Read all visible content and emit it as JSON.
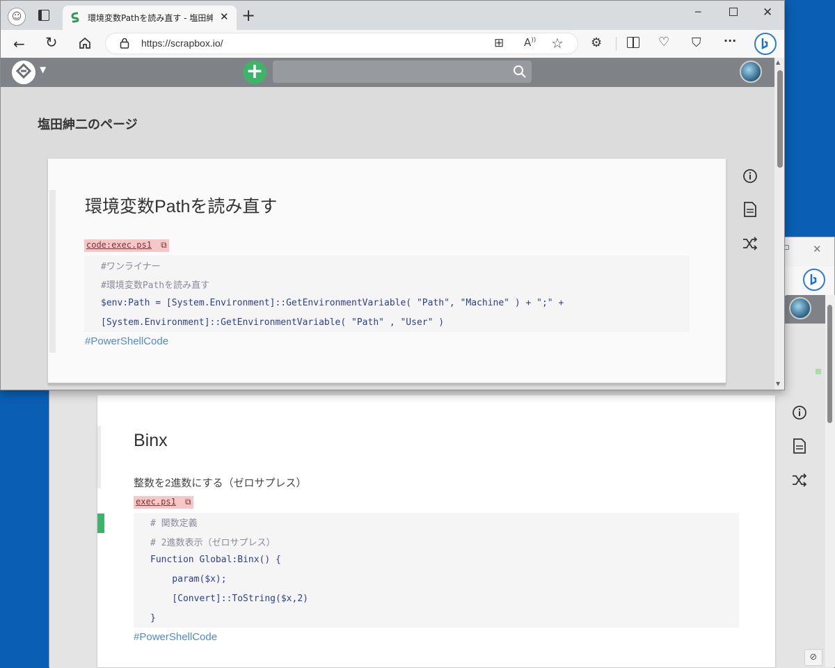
{
  "browser": {
    "tab_title": "環境変数Pathを読み直す - 塩田紳",
    "url": "https://scrapbox.io/",
    "new_tab": "+",
    "minimize": "─",
    "maximize": "☐",
    "close": "✕",
    "more": "···"
  },
  "scrapbox": {
    "project_title": "塩田紳二のページ",
    "search_placeholder": ""
  },
  "page1": {
    "title": "環境変数Pathを読み直す",
    "code_label": "code:exec.ps1",
    "code_lines": [
      "#ワンライナー",
      "#環境変数Pathを読み直す",
      "$env:Path = [System.Environment]::GetEnvironmentVariable( \"Path\", \"Machine\" ) + \";\" +",
      "[System.Environment]::GetEnvironmentVariable( \"Path\" , \"User\" )"
    ],
    "hashtag": "#PowerShellCode"
  },
  "page2": {
    "title": "Binx",
    "description": "整数を2進数にする（ゼロサプレス）",
    "code_label": "exec.ps1",
    "code_lines": [
      "# 関数定義",
      "# 2進数表示（ゼロサプレス）",
      "Function Global:Binx() {",
      "    param($x);",
      "    [Convert]::ToString($x,2)",
      "}"
    ],
    "hashtag": "#PowerShellCode"
  },
  "colors": {
    "accent_green": "#3fb36a",
    "hashtag_blue": "#4f88d6",
    "code_label_bg": "#f7c6c6",
    "desktop_blue": "#0a5fb4"
  },
  "icons": [
    "info-icon",
    "page-icon",
    "shuffle-icon",
    "copy-icon",
    "search-icon",
    "add-icon",
    "bing-icon"
  ]
}
